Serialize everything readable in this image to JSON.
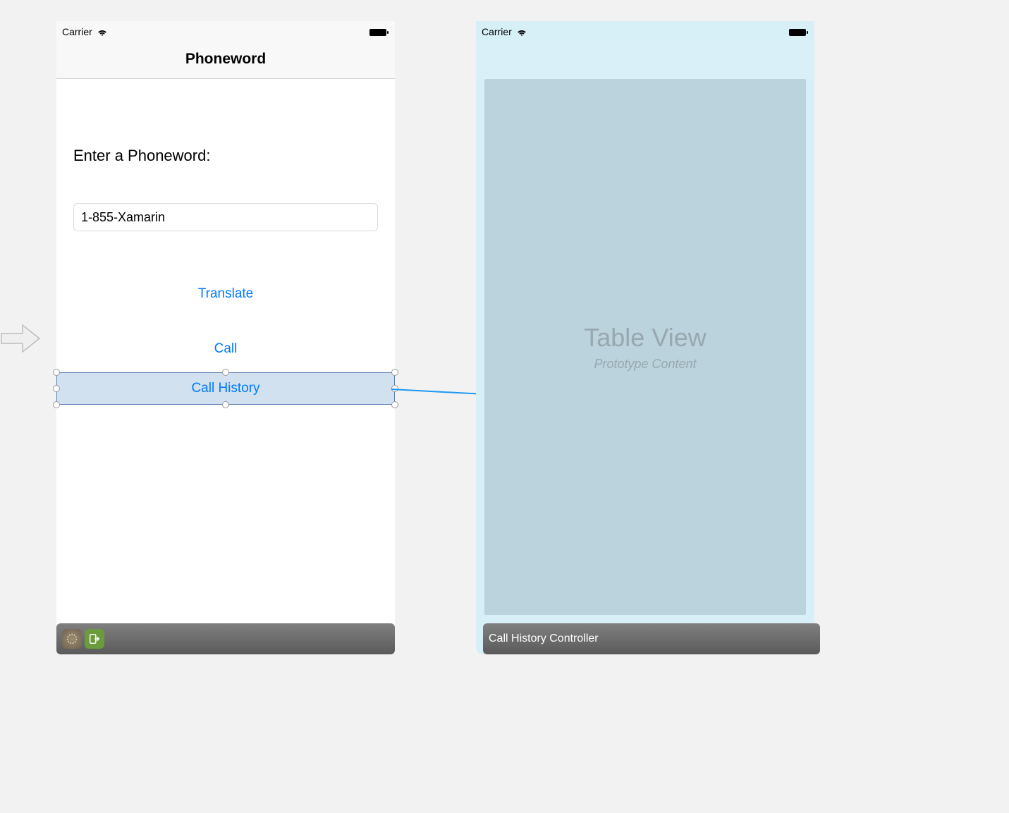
{
  "status": {
    "carrier": "Carrier"
  },
  "leftPhone": {
    "navTitle": "Phoneword",
    "enterLabel": "Enter a Phoneword:",
    "inputValue": "1-855-Xamarin",
    "translateButton": "Translate",
    "callButton": "Call",
    "callHistoryButton": "Call History"
  },
  "rightPhone": {
    "tableViewTitle": "Table View",
    "tableViewSubtitle": "Prototype Content",
    "controllerLabel": "Call History Controller"
  }
}
